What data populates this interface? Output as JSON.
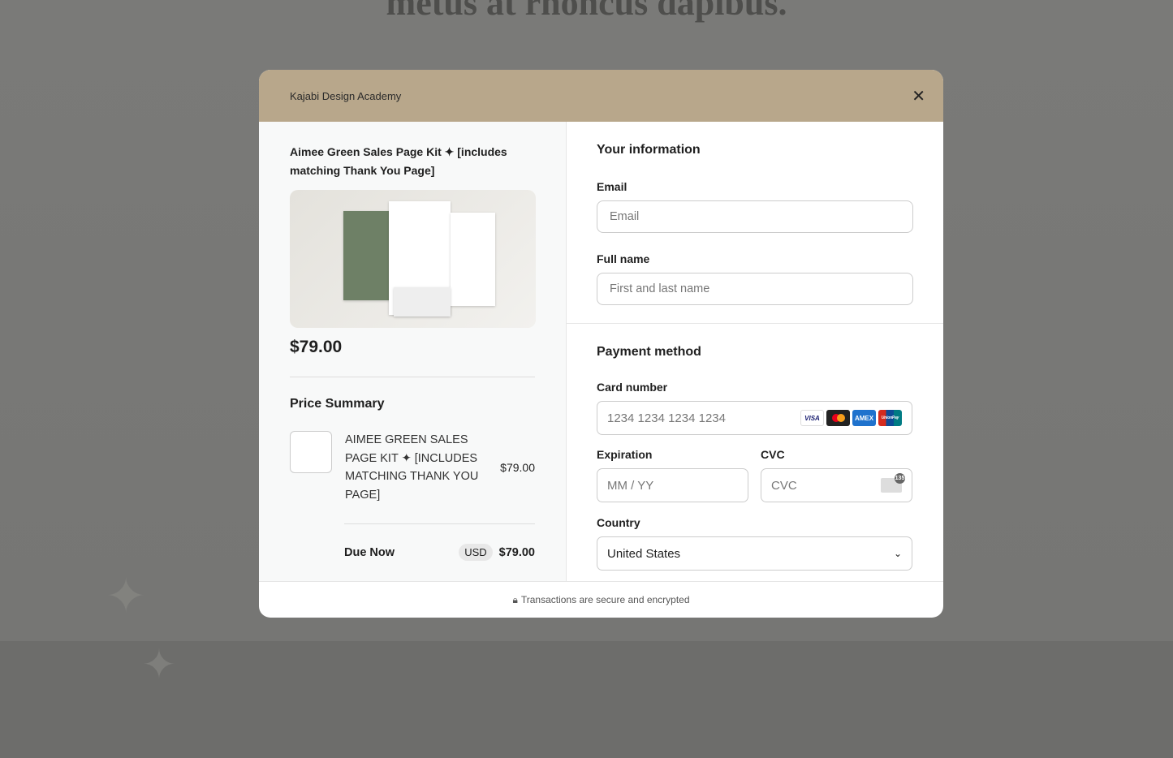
{
  "background": {
    "heading": "metus at rhoncus dapibus."
  },
  "modal": {
    "header_title": "Kajabi Design Academy",
    "product": {
      "title": "Aimee Green Sales Page Kit ✦ [includes matching Thank You Page]",
      "price": "$79.00"
    },
    "summary": {
      "title": "Price Summary",
      "item_name": "AIMEE GREEN SALES PAGE KIT ✦ [INCLUDES MATCHING THANK YOU PAGE]",
      "item_price": "$79.00",
      "due_label": "Due Now",
      "currency": "USD",
      "due_amount": "$79.00"
    },
    "info": {
      "title": "Your information",
      "email_label": "Email",
      "email_placeholder": "Email",
      "name_label": "Full name",
      "name_placeholder": "First and last name"
    },
    "payment": {
      "title": "Payment method",
      "card_label": "Card number",
      "card_placeholder": "1234 1234 1234 1234",
      "card_brands": [
        "VISA",
        "Mastercard",
        "AMEX",
        "UnionPay"
      ],
      "exp_label": "Expiration",
      "exp_placeholder": "MM / YY",
      "cvc_label": "CVC",
      "cvc_placeholder": "CVC",
      "cvc_hint": "135",
      "country_label": "Country",
      "country_value": "United States"
    },
    "footer": "Transactions are secure and encrypted"
  },
  "colors": {
    "header": "#b8a78b"
  }
}
